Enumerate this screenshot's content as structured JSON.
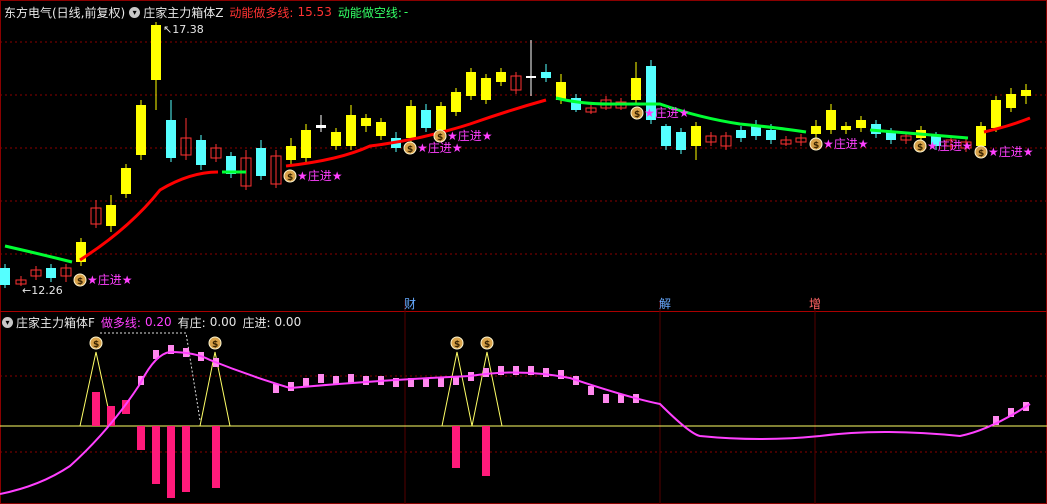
{
  "top": {
    "stock": "东方电气(日线,前复权)",
    "indicator": "庄家主力箱体Z",
    "bull_label": "动能做多线:",
    "bull_value": "15.53",
    "bear_label": "动能做空线:",
    "bear_value": "-",
    "high_mark": "17.38",
    "low_mark": "12.26"
  },
  "bottom": {
    "indicator": "庄家主力箱体F",
    "long_label": "做多线:",
    "long_value": "0.20",
    "zhuang_label": "有庄:",
    "zhuang_value": "0.00",
    "enter_label": "庄进:",
    "enter_value": "0.00"
  },
  "signal_text": "★庄进★",
  "money_glyph": "$",
  "events": [
    "财",
    "解",
    "增"
  ],
  "icons": {
    "menu": "circle-chevron-icon",
    "money": "money-bag-icon"
  },
  "colors": {
    "up_yang": "#ffff00",
    "down_yin": "#55ffff",
    "hollow_red": "#ff3232",
    "bull_line": "#ff0000",
    "bear_line": "#00ff33",
    "magenta_line": "#ff40ff",
    "signal_text": "#ff40ff",
    "pink_bar": "#ff1a7a",
    "light_pink": "#ff88ee",
    "grid": "#8a0000",
    "yellow_line": "#ffff66"
  }
}
